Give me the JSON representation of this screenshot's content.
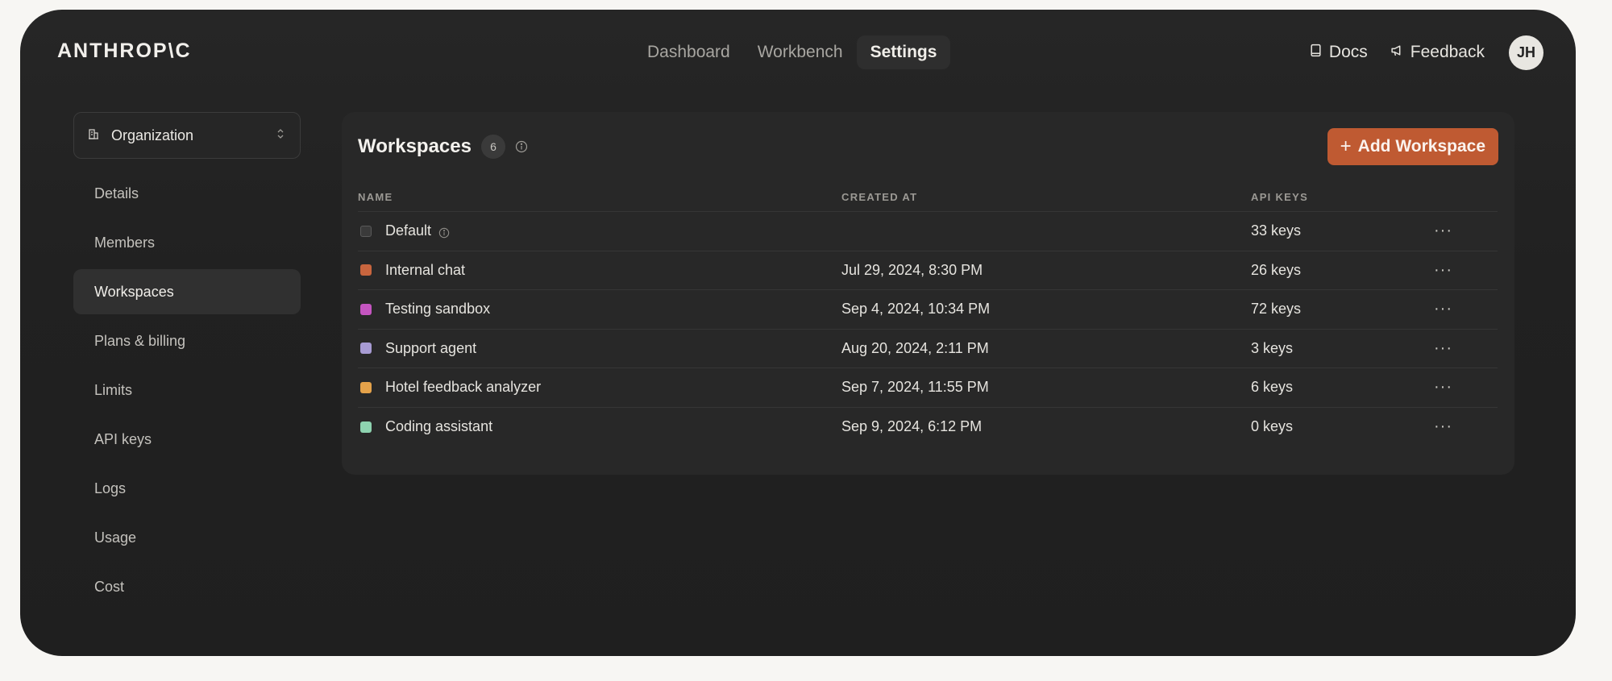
{
  "brand": {
    "logo_text": "ANTHROP\\C"
  },
  "topnav": {
    "items": [
      {
        "label": "Dashboard",
        "active": false
      },
      {
        "label": "Workbench",
        "active": false
      },
      {
        "label": "Settings",
        "active": true
      }
    ]
  },
  "topright": {
    "docs_label": "Docs",
    "feedback_label": "Feedback",
    "avatar_initials": "JH"
  },
  "sidebar": {
    "org_select_label": "Organization",
    "items": [
      {
        "label": "Details",
        "active": false
      },
      {
        "label": "Members",
        "active": false
      },
      {
        "label": "Workspaces",
        "active": true
      },
      {
        "label": "Plans & billing",
        "active": false
      },
      {
        "label": "Limits",
        "active": false
      },
      {
        "label": "API keys",
        "active": false
      },
      {
        "label": "Logs",
        "active": false
      },
      {
        "label": "Usage",
        "active": false
      },
      {
        "label": "Cost",
        "active": false
      }
    ]
  },
  "workspaces": {
    "title": "Workspaces",
    "count": "6",
    "add_button_label": "Add Workspace",
    "columns": {
      "name": "NAME",
      "created_at": "CREATED AT",
      "api_keys": "API KEYS"
    },
    "rows": [
      {
        "name": "Default",
        "created_at": "",
        "api_keys": "33 keys",
        "color": "#3a3a3a",
        "has_info": true
      },
      {
        "name": "Internal chat",
        "created_at": "Jul 29, 2024, 8:30 PM",
        "api_keys": "26 keys",
        "color": "#c8653e",
        "has_info": false
      },
      {
        "name": "Testing sandbox",
        "created_at": "Sep 4, 2024, 10:34 PM",
        "api_keys": "72 keys",
        "color": "#c455c0",
        "has_info": false
      },
      {
        "name": "Support agent",
        "created_at": "Aug 20, 2024, 2:11 PM",
        "api_keys": "3 keys",
        "color": "#a79bd3",
        "has_info": false
      },
      {
        "name": "Hotel feedback analyzer",
        "created_at": "Sep 7, 2024, 11:55 PM",
        "api_keys": "6 keys",
        "color": "#e4a24a",
        "has_info": false
      },
      {
        "name": "Coding assistant",
        "created_at": "Sep 9, 2024, 6:12 PM",
        "api_keys": "0 keys",
        "color": "#8ed3b0",
        "has_info": false
      }
    ]
  },
  "colors": {
    "accent": "#bf5a32",
    "window_bg": "#212121",
    "panel_bg": "#282828"
  }
}
